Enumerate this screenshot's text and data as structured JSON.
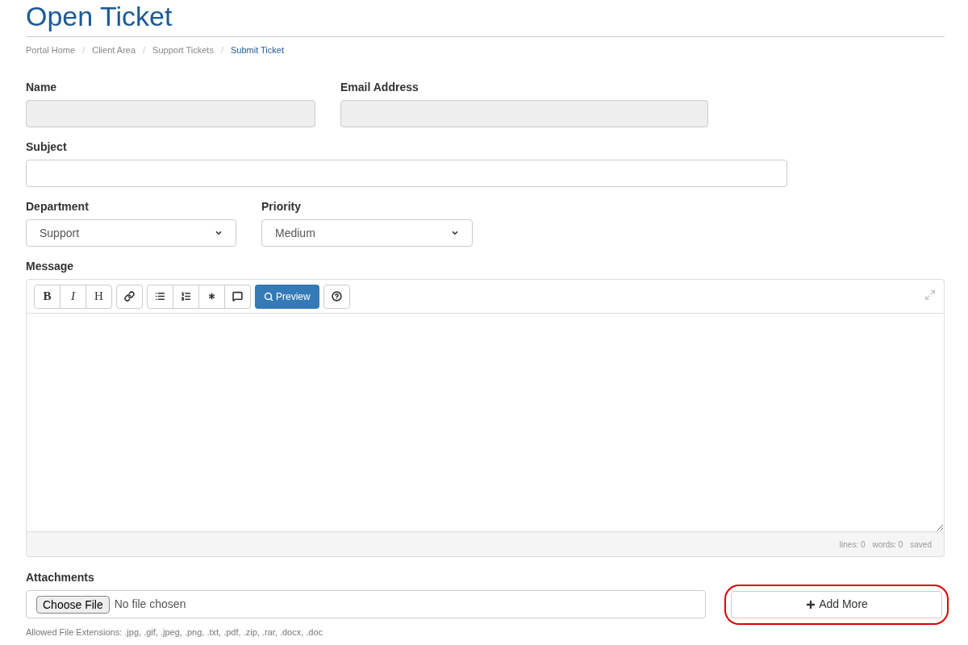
{
  "title": "Open Ticket",
  "breadcrumb": [
    {
      "label": "Portal Home",
      "selected": false
    },
    {
      "label": "Client Area",
      "selected": false
    },
    {
      "label": "Support Tickets",
      "selected": false
    },
    {
      "label": "Submit Ticket",
      "selected": true
    }
  ],
  "breadcrumb_separator": "/",
  "fields": {
    "name": {
      "label": "Name",
      "disabled": true
    },
    "email": {
      "label": "Email Address",
      "disabled": true
    },
    "subject": {
      "label": "Subject",
      "disabled": false
    },
    "department": {
      "label": "Department",
      "value": "Support"
    },
    "priority": {
      "label": "Priority",
      "value": "Medium"
    }
  },
  "message": {
    "label": "Message",
    "toolbar": [
      [
        {
          "kind": "bold",
          "text": "B"
        },
        {
          "kind": "italic",
          "text": "I"
        },
        {
          "kind": "heading",
          "text": "H"
        }
      ],
      [
        {
          "kind": "link"
        }
      ],
      [
        {
          "kind": "bullets"
        },
        {
          "kind": "numbers"
        },
        {
          "kind": "asterisk"
        },
        {
          "kind": "comment"
        }
      ],
      [
        {
          "kind": "preview",
          "text": "Preview"
        }
      ],
      [
        {
          "kind": "help"
        }
      ]
    ],
    "status": [
      "lines: 0",
      "words: 0",
      "saved"
    ]
  },
  "attachments": {
    "label": "Attachments",
    "choose_button": "Choose File",
    "file_status": "No file chosen",
    "add_more": "Add More",
    "highlighted": true,
    "help": "Allowed File Extensions: .jpg, .gif, .jpeg, .png, .txt, .pdf, .zip, .rar, .docx, .doc"
  }
}
